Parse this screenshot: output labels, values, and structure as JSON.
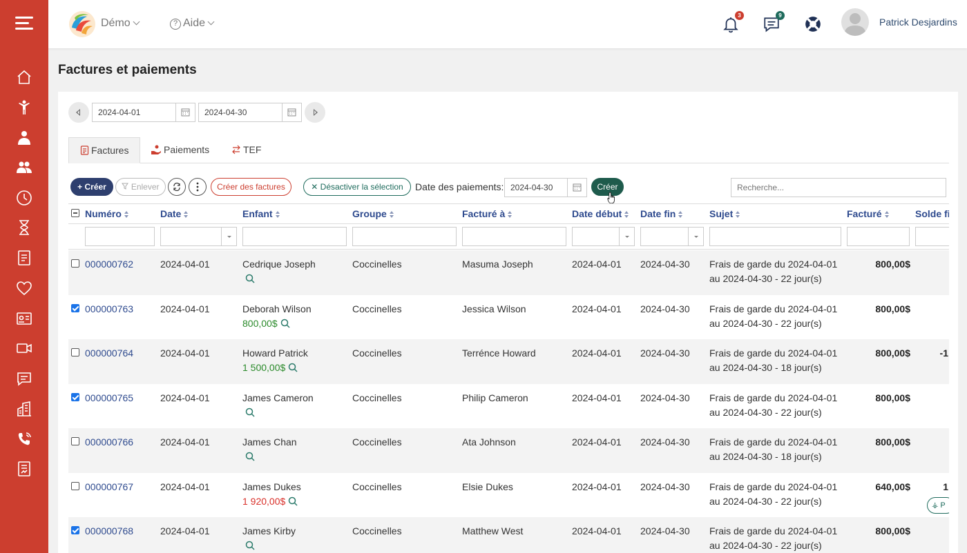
{
  "header": {
    "org_name": "Démo",
    "help_label": "Aide",
    "notifications_count": "3",
    "messages_count": "9",
    "user_name": "Patrick Desjardins"
  },
  "page": {
    "title": "Factures et paiements"
  },
  "date_range": {
    "start": "2024-04-01",
    "end": "2024-04-30"
  },
  "tabs": [
    {
      "label": "Factures"
    },
    {
      "label": "Paiements"
    },
    {
      "label": "TEF"
    }
  ],
  "toolbar": {
    "create_label": "+ Créer",
    "remove_label": "Enlever",
    "create_invoices_label": "Créer des factures",
    "deactivate_label": "Désactiver la sélection",
    "payment_date_label": "Date des paiements:",
    "payment_date_value": "2024-04-30",
    "create_payment_label": "Créer",
    "search_placeholder": "Recherche..."
  },
  "columns": [
    "Numéro",
    "Date",
    "Enfant",
    "Groupe",
    "Facturé à",
    "Date début",
    "Date fin",
    "Sujet",
    "Facturé",
    "Solde fi"
  ],
  "rows": [
    {
      "checked": false,
      "number": "000000762",
      "date": "2024-04-01",
      "child": "Cedrique Joseph",
      "balance": "",
      "balance_color": "",
      "group": "Coccinelles",
      "billed_to": "Masuma Joseph",
      "start": "2024-04-01",
      "end": "2024-04-30",
      "subject1": "Frais de garde du 2024-04-01",
      "subject2": "au 2024-04-30 - 22 jour(s)",
      "billed": "800,00$",
      "remaining": ""
    },
    {
      "checked": true,
      "number": "000000763",
      "date": "2024-04-01",
      "child": "Deborah Wilson",
      "balance": "800,00$",
      "balance_color": "green",
      "group": "Coccinelles",
      "billed_to": "Jessica Wilson",
      "start": "2024-04-01",
      "end": "2024-04-30",
      "subject1": "Frais de garde du 2024-04-01",
      "subject2": "au 2024-04-30 - 22 jour(s)",
      "billed": "800,00$",
      "remaining": ""
    },
    {
      "checked": false,
      "number": "000000764",
      "date": "2024-04-01",
      "child": "Howard Patrick",
      "balance": "1 500,00$",
      "balance_color": "green",
      "group": "Coccinelles",
      "billed_to": "Terrénce Howard",
      "start": "2024-04-01",
      "end": "2024-04-30",
      "subject1": "Frais de garde du 2024-04-01",
      "subject2": "au 2024-04-30 - 18 jour(s)",
      "billed": "800,00$",
      "remaining": "-1"
    },
    {
      "checked": true,
      "number": "000000765",
      "date": "2024-04-01",
      "child": "James Cameron",
      "balance": "",
      "balance_color": "",
      "group": "Coccinelles",
      "billed_to": "Philip Cameron",
      "start": "2024-04-01",
      "end": "2024-04-30",
      "subject1": "Frais de garde du 2024-04-01",
      "subject2": "au 2024-04-30 - 22 jour(s)",
      "billed": "800,00$",
      "remaining": ""
    },
    {
      "checked": false,
      "number": "000000766",
      "date": "2024-04-01",
      "child": "James Chan",
      "balance": "",
      "balance_color": "",
      "group": "Coccinelles",
      "billed_to": "Ata Johnson",
      "start": "2024-04-01",
      "end": "2024-04-30",
      "subject1": "Frais de garde du 2024-04-01",
      "subject2": "au 2024-04-30 - 18 jour(s)",
      "billed": "800,00$",
      "remaining": ""
    },
    {
      "checked": false,
      "number": "000000767",
      "date": "2024-04-01",
      "child": "James Dukes",
      "balance": "1 920,00$",
      "balance_color": "red",
      "group": "Coccinelles",
      "billed_to": "Elsie Dukes",
      "start": "2024-04-01",
      "end": "2024-04-30",
      "subject1": "Frais de garde du 2024-04-01",
      "subject2": "au 2024-04-30 - 22 jour(s)",
      "billed": "640,00$",
      "remaining": "1",
      "pay_label": "P"
    },
    {
      "checked": true,
      "number": "000000768",
      "date": "2024-04-01",
      "child": "James Kirby",
      "balance": "",
      "balance_color": "",
      "group": "Coccinelles",
      "billed_to": "Matthew West",
      "start": "2024-04-01",
      "end": "2024-04-30",
      "subject1": "Frais de garde du 2024-04-01",
      "subject2": "au 2024-04-30 - 22 jour(s)",
      "billed": "800,00$",
      "remaining": ""
    }
  ],
  "colors": {
    "sidebar": "#cc3e2f",
    "primary": "#2e3f6e",
    "teal": "#1e5b4c",
    "link": "#2e4a8e",
    "positive": "#2a8a2a",
    "negative": "#d9302a"
  }
}
